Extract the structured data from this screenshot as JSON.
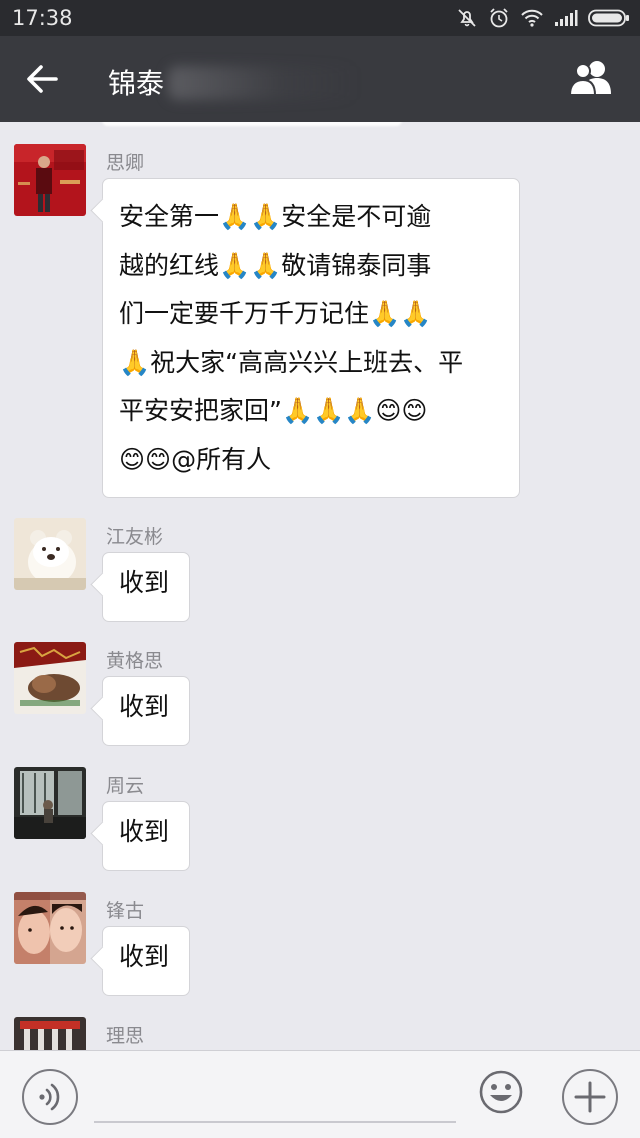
{
  "status_bar": {
    "time": "17:38",
    "icons": [
      "mute-icon",
      "alarm-icon",
      "wifi-icon",
      "signal-icon",
      "battery-icon"
    ]
  },
  "header": {
    "title": "锦泰",
    "back_icon": "arrow-left-icon",
    "group_icon": "group-members-icon"
  },
  "messages": [
    {
      "sender": "思卿",
      "lines": [
        "安全第一🙏🙏安全是不可逾",
        "越的红线🙏🙏敬请锦泰同事",
        "们一定要千万千万记住🙏🙏",
        "🙏祝大家“高高兴兴上班去、平",
        "平安安把家回”🙏🙏🙏😊😊",
        "😊😊@所有人"
      ]
    },
    {
      "sender": "江友彬",
      "text": "收到"
    },
    {
      "sender": "黄格思",
      "text": "收到"
    },
    {
      "sender": "周云",
      "text": "收到"
    },
    {
      "sender": "锋古",
      "text": "收到"
    },
    {
      "sender": "理思"
    }
  ],
  "input_bar": {
    "voice_icon": "voice-icon",
    "emoji_icon": "emoji-icon",
    "plus_icon": "plus-icon",
    "placeholder": ""
  },
  "colors": {
    "status_bar": "#2a2b2f",
    "nav_bar": "#393a3f",
    "chat_bg": "#e9e9ee",
    "bubble": "#ffffff"
  }
}
